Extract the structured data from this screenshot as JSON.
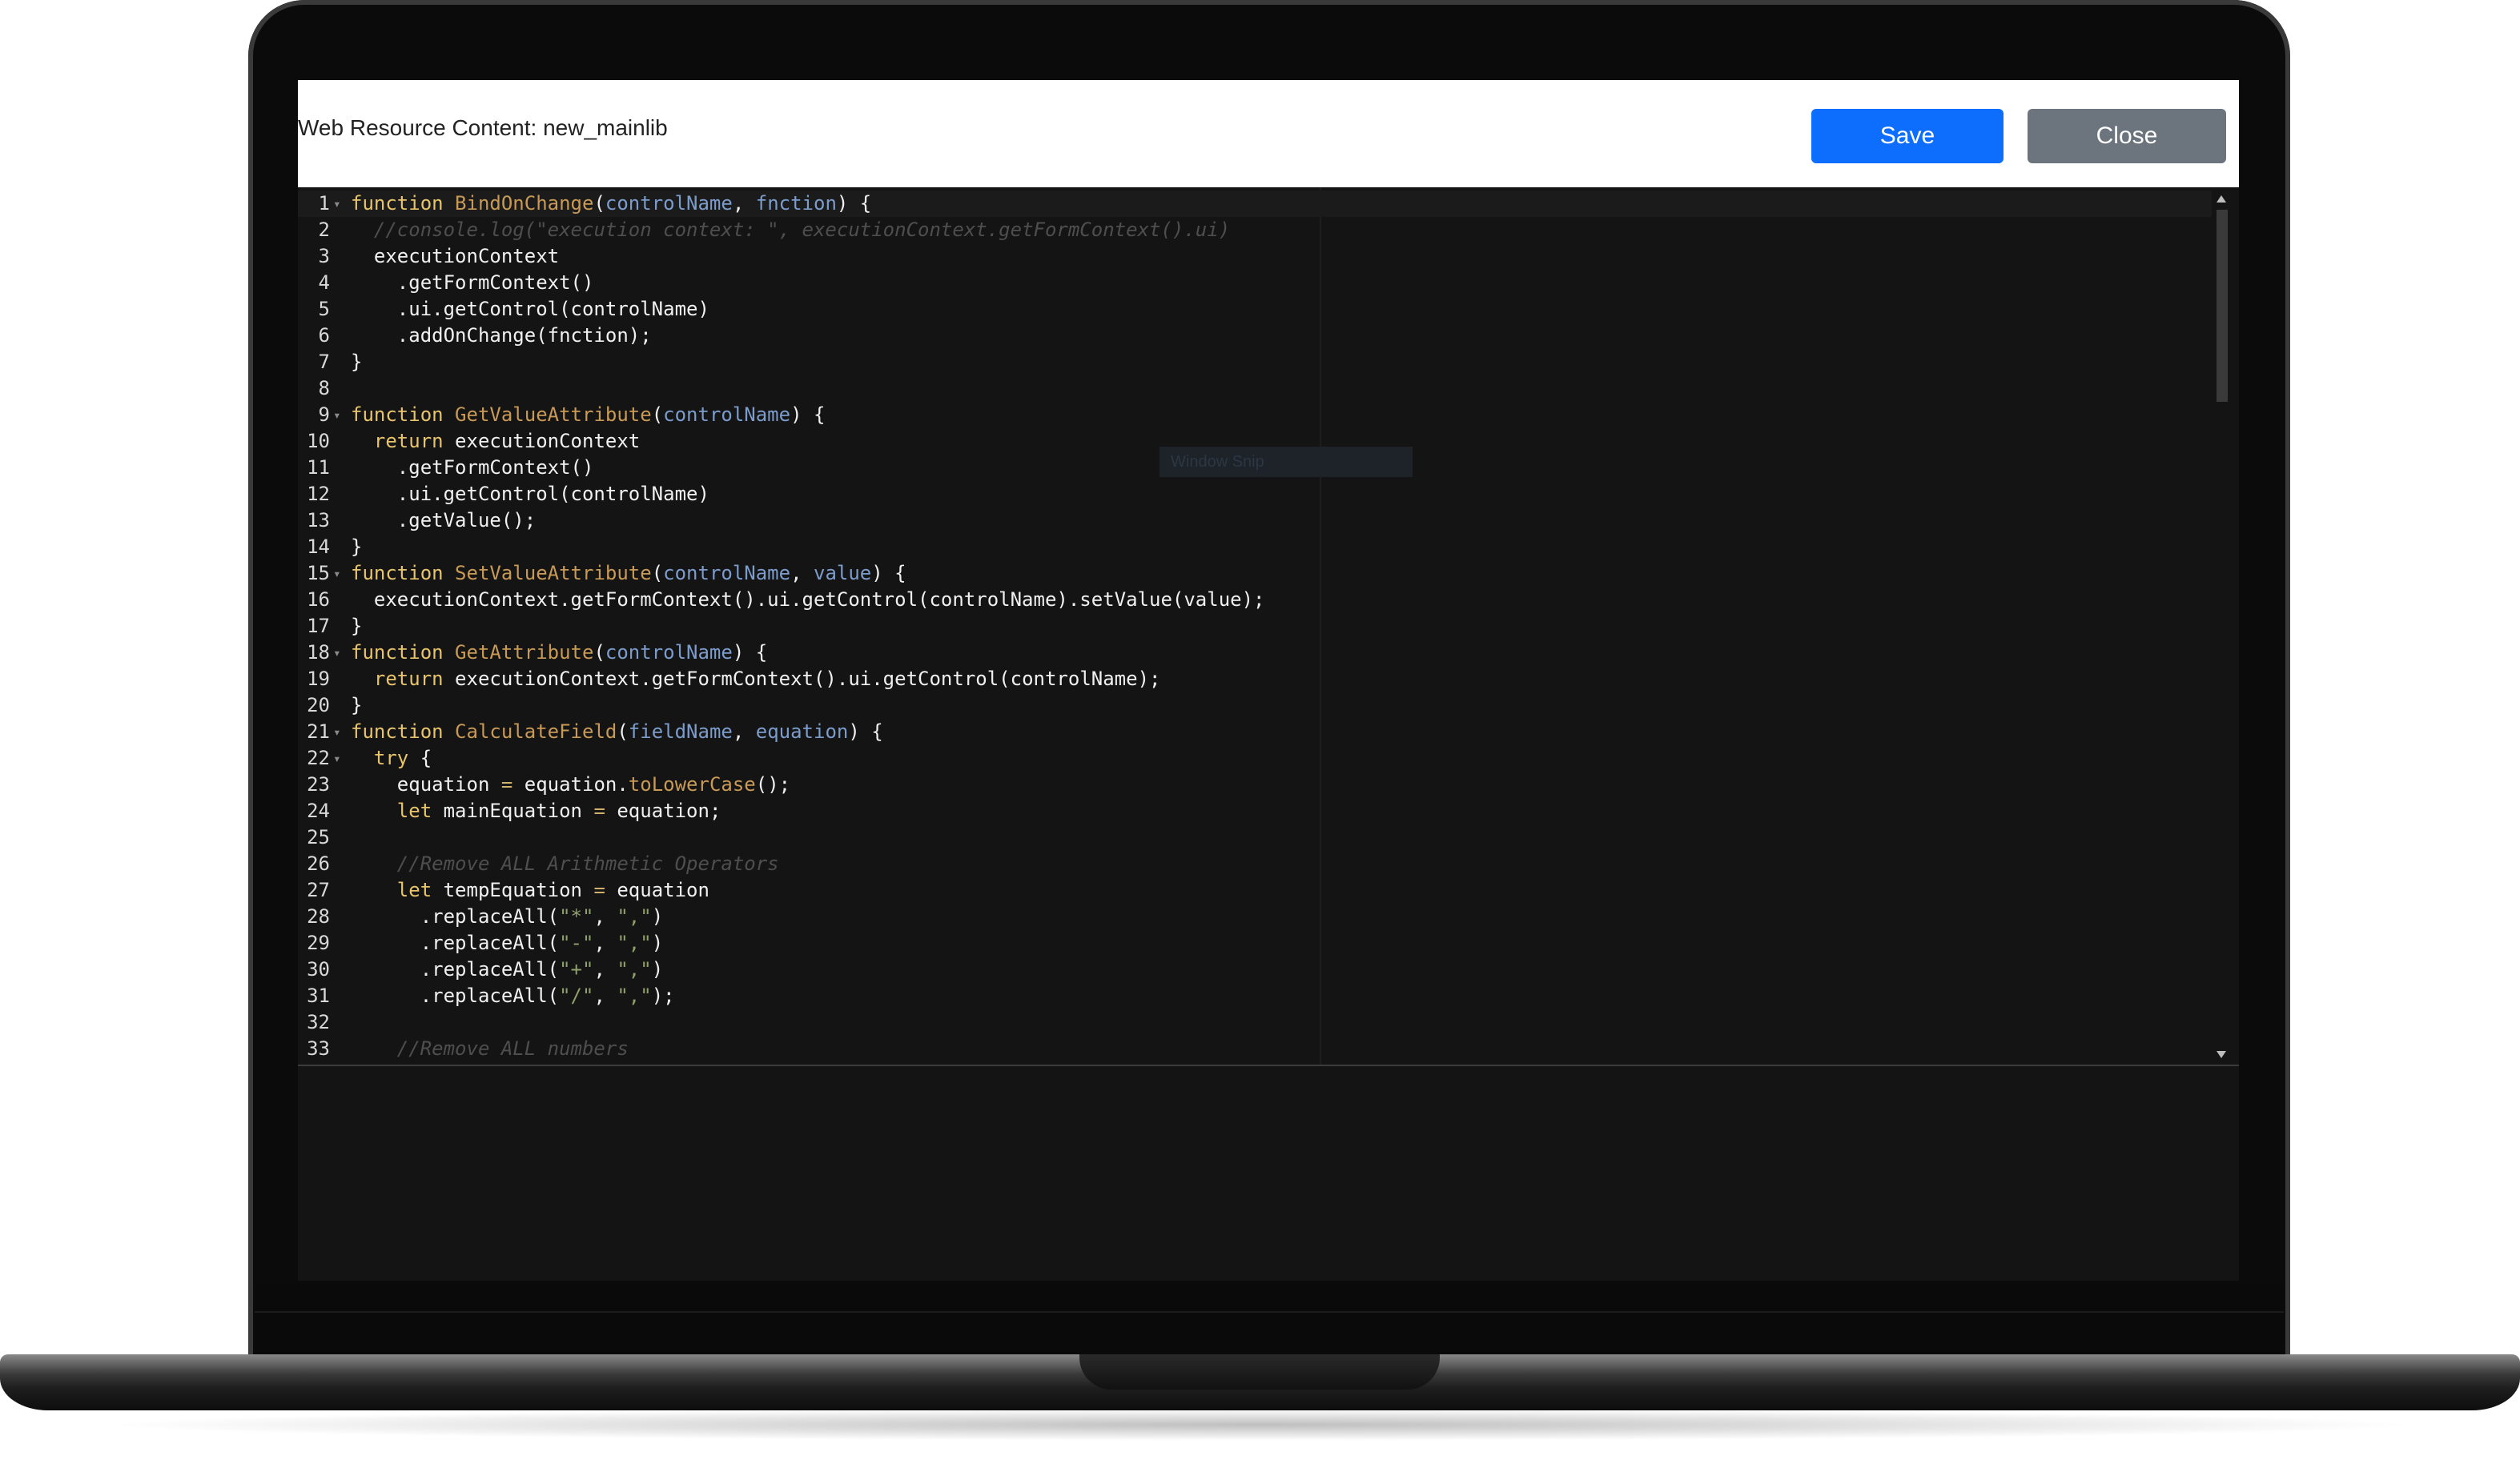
{
  "dialog": {
    "title": "Web Resource Content: new_mainlib",
    "save_label": "Save",
    "close_label": "Close"
  },
  "colors": {
    "save_button": "#0d6efd",
    "close_button": "#6c757d",
    "editor_background": "#141414",
    "keyword": "#e8c46a",
    "function_name": "#c99a55",
    "parameter": "#7c9ccc",
    "comment": "#4e4e4e"
  },
  "ghost_tooltip": "Window Snip",
  "editor": {
    "lines": [
      {
        "n": "1",
        "fold": true,
        "tokens": [
          [
            "kw",
            "function"
          ],
          [
            "pl",
            " "
          ],
          [
            "fn",
            "BindOnChange"
          ],
          [
            "pl",
            "("
          ],
          [
            "pr",
            "controlName"
          ],
          [
            "pl",
            ", "
          ],
          [
            "pr",
            "fnction"
          ],
          [
            "pl",
            ") {"
          ]
        ]
      },
      {
        "n": "2",
        "fold": false,
        "tokens": [
          [
            "pl",
            "  "
          ],
          [
            "cm",
            "//console.log(\"execution context: \", executionContext.getFormContext().ui)"
          ]
        ]
      },
      {
        "n": "3",
        "fold": false,
        "tokens": [
          [
            "pl",
            "  executionContext"
          ]
        ]
      },
      {
        "n": "4",
        "fold": false,
        "tokens": [
          [
            "pl",
            "    .getFormContext()"
          ]
        ]
      },
      {
        "n": "5",
        "fold": false,
        "tokens": [
          [
            "pl",
            "    .ui.getControl(controlName)"
          ]
        ]
      },
      {
        "n": "6",
        "fold": false,
        "tokens": [
          [
            "pl",
            "    .addOnChange(fnction);"
          ]
        ]
      },
      {
        "n": "7",
        "fold": false,
        "tokens": [
          [
            "pl",
            "}"
          ]
        ]
      },
      {
        "n": "8",
        "fold": false,
        "tokens": [
          [
            "pl",
            ""
          ]
        ]
      },
      {
        "n": "9",
        "fold": true,
        "tokens": [
          [
            "kw",
            "function"
          ],
          [
            "pl",
            " "
          ],
          [
            "fn",
            "GetValueAttribute"
          ],
          [
            "pl",
            "("
          ],
          [
            "pr",
            "controlName"
          ],
          [
            "pl",
            ") {"
          ]
        ]
      },
      {
        "n": "10",
        "fold": false,
        "tokens": [
          [
            "pl",
            "  "
          ],
          [
            "kw",
            "return"
          ],
          [
            "pl",
            " executionContext"
          ]
        ]
      },
      {
        "n": "11",
        "fold": false,
        "tokens": [
          [
            "pl",
            "    .getFormContext()"
          ]
        ]
      },
      {
        "n": "12",
        "fold": false,
        "tokens": [
          [
            "pl",
            "    .ui.getControl(controlName)"
          ]
        ]
      },
      {
        "n": "13",
        "fold": false,
        "tokens": [
          [
            "pl",
            "    .getValue();"
          ]
        ]
      },
      {
        "n": "14",
        "fold": false,
        "tokens": [
          [
            "pl",
            "}"
          ]
        ]
      },
      {
        "n": "15",
        "fold": true,
        "tokens": [
          [
            "kw",
            "function"
          ],
          [
            "pl",
            " "
          ],
          [
            "fn",
            "SetValueAttribute"
          ],
          [
            "pl",
            "("
          ],
          [
            "pr",
            "controlName"
          ],
          [
            "pl",
            ", "
          ],
          [
            "pr",
            "value"
          ],
          [
            "pl",
            ") {"
          ]
        ]
      },
      {
        "n": "16",
        "fold": false,
        "tokens": [
          [
            "pl",
            "  executionContext.getFormContext().ui.getControl(controlName).setValue(value);"
          ]
        ]
      },
      {
        "n": "17",
        "fold": false,
        "tokens": [
          [
            "pl",
            "}"
          ]
        ]
      },
      {
        "n": "18",
        "fold": true,
        "tokens": [
          [
            "kw",
            "function"
          ],
          [
            "pl",
            " "
          ],
          [
            "fn",
            "GetAttribute"
          ],
          [
            "pl",
            "("
          ],
          [
            "pr",
            "controlName"
          ],
          [
            "pl",
            ") {"
          ]
        ]
      },
      {
        "n": "19",
        "fold": false,
        "tokens": [
          [
            "pl",
            "  "
          ],
          [
            "kw",
            "return"
          ],
          [
            "pl",
            " executionContext.getFormContext().ui.getControl(controlName);"
          ]
        ]
      },
      {
        "n": "20",
        "fold": false,
        "tokens": [
          [
            "pl",
            "}"
          ]
        ]
      },
      {
        "n": "21",
        "fold": true,
        "tokens": [
          [
            "kw",
            "function"
          ],
          [
            "pl",
            " "
          ],
          [
            "fn",
            "CalculateField"
          ],
          [
            "pl",
            "("
          ],
          [
            "pr",
            "fieldName"
          ],
          [
            "pl",
            ", "
          ],
          [
            "pr",
            "equation"
          ],
          [
            "pl",
            ") {"
          ]
        ]
      },
      {
        "n": "22",
        "fold": true,
        "tokens": [
          [
            "pl",
            "  "
          ],
          [
            "kw",
            "try"
          ],
          [
            "pl",
            " {"
          ]
        ]
      },
      {
        "n": "23",
        "fold": false,
        "tokens": [
          [
            "pl",
            "    equation "
          ],
          [
            "op",
            "="
          ],
          [
            "pl",
            " equation."
          ],
          [
            "mt",
            "toLowerCase"
          ],
          [
            "pl",
            "();"
          ]
        ]
      },
      {
        "n": "24",
        "fold": false,
        "tokens": [
          [
            "pl",
            "    "
          ],
          [
            "kw",
            "let"
          ],
          [
            "pl",
            " mainEquation "
          ],
          [
            "op",
            "="
          ],
          [
            "pl",
            " equation;"
          ]
        ]
      },
      {
        "n": "25",
        "fold": false,
        "tokens": [
          [
            "pl",
            ""
          ]
        ]
      },
      {
        "n": "26",
        "fold": false,
        "tokens": [
          [
            "pl",
            "    "
          ],
          [
            "cm",
            "//Remove ALL Arithmetic Operators"
          ]
        ]
      },
      {
        "n": "27",
        "fold": false,
        "tokens": [
          [
            "pl",
            "    "
          ],
          [
            "kw",
            "let"
          ],
          [
            "pl",
            " tempEquation "
          ],
          [
            "op",
            "="
          ],
          [
            "pl",
            " equation"
          ]
        ]
      },
      {
        "n": "28",
        "fold": false,
        "tokens": [
          [
            "pl",
            "      .replaceAll("
          ],
          [
            "st",
            "\"*\""
          ],
          [
            "pl",
            ", "
          ],
          [
            "st",
            "\",\""
          ],
          [
            "pl",
            ")"
          ]
        ]
      },
      {
        "n": "29",
        "fold": false,
        "tokens": [
          [
            "pl",
            "      .replaceAll("
          ],
          [
            "st",
            "\"-\""
          ],
          [
            "pl",
            ", "
          ],
          [
            "st",
            "\",\""
          ],
          [
            "pl",
            ")"
          ]
        ]
      },
      {
        "n": "30",
        "fold": false,
        "tokens": [
          [
            "pl",
            "      .replaceAll("
          ],
          [
            "st",
            "\"+\""
          ],
          [
            "pl",
            ", "
          ],
          [
            "st",
            "\",\""
          ],
          [
            "pl",
            ")"
          ]
        ]
      },
      {
        "n": "31",
        "fold": false,
        "tokens": [
          [
            "pl",
            "      .replaceAll("
          ],
          [
            "st",
            "\"/\""
          ],
          [
            "pl",
            ", "
          ],
          [
            "st",
            "\",\""
          ],
          [
            "pl",
            ");"
          ]
        ]
      },
      {
        "n": "32",
        "fold": false,
        "tokens": [
          [
            "pl",
            ""
          ]
        ]
      },
      {
        "n": "33",
        "fold": false,
        "tokens": [
          [
            "pl",
            "    "
          ],
          [
            "cm",
            "//Remove ALL numbers"
          ]
        ]
      }
    ]
  }
}
